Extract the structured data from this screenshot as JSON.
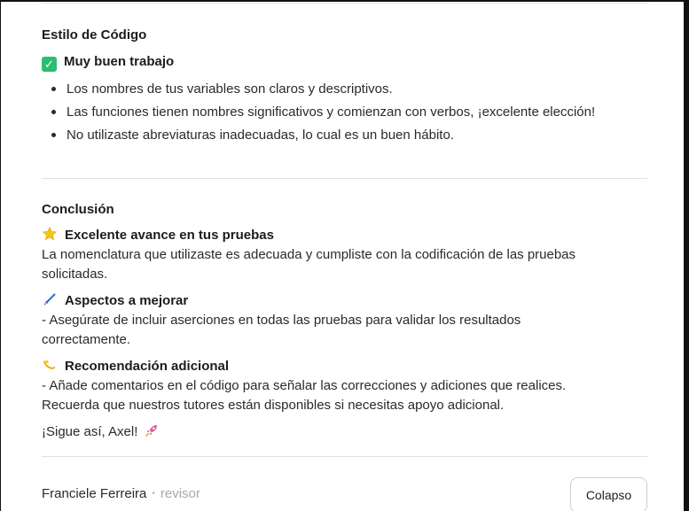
{
  "code_style": {
    "title": "Estilo de Código",
    "badge_label": "Muy buen trabajo",
    "badge_icon": "check-mark-icon",
    "bullets": [
      "Los nombres de tus variables son claros y descriptivos.",
      "Las funciones tienen nombres significativos y comienzan con verbos, ¡excelente elección!",
      "No utilizaste abreviaturas inadecuadas, lo cual es un buen hábito."
    ]
  },
  "conclusion": {
    "title": "Conclusión",
    "highlight": {
      "icon": "star-icon",
      "heading": "Excelente avance en tus pruebas",
      "line1": "La nomenclatura que utilizaste es adecuada y cumpliste con la codificación de las pruebas",
      "line2": "solicitadas."
    },
    "improve": {
      "icon": "pen-icon",
      "heading": "Aspectos a mejorar",
      "line1": "- Asegúrate de incluir aserciones en todas las pruebas para validar los resultados",
      "line2": "correctamente."
    },
    "recommendation": {
      "icon": "dizzy-icon",
      "heading": "Recomendación adicional",
      "line1": "- Añade comentarios en el código para señalar las correcciones y adiciones que realices.",
      "line2": "Recuerda que nuestros tutores están disponibles si necesitas apoyo adicional."
    },
    "closing": "¡Sigue así, Axel!",
    "closing_icon": "rocket-icon"
  },
  "reviewer": {
    "name": "Franciele Ferreira",
    "separator": "•",
    "role": "revisor"
  },
  "actions": {
    "collapse_label": "Colapso"
  },
  "colors": {
    "check": "#2dbd6e",
    "star": "#f5c518",
    "pen": "#2f6fd6",
    "dizzy": "#f0a500",
    "rocket": "#e05a9a"
  }
}
